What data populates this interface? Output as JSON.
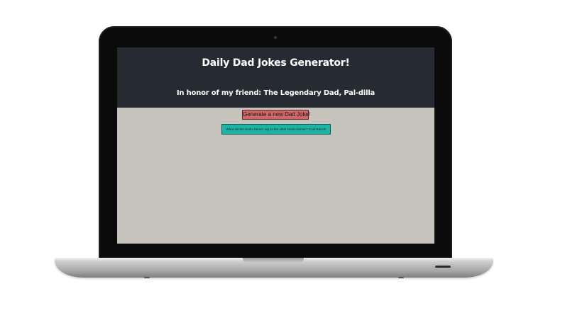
{
  "site": {
    "title": "Daily Dad Jokes Generator!",
    "subtitle": "In honor of my friend: The Legendary Dad, Pal-dilla",
    "header_color": "#262a31",
    "page_bg_color": "#c5c3bc"
  },
  "generate_button": {
    "label": "Generate a new Dad Joke!",
    "color": "#cf6565"
  },
  "joke": {
    "text": "What did the Dorito farmer say to the other Dorito farmer? Cool Ranch!",
    "color": "#1fb3a8"
  }
}
